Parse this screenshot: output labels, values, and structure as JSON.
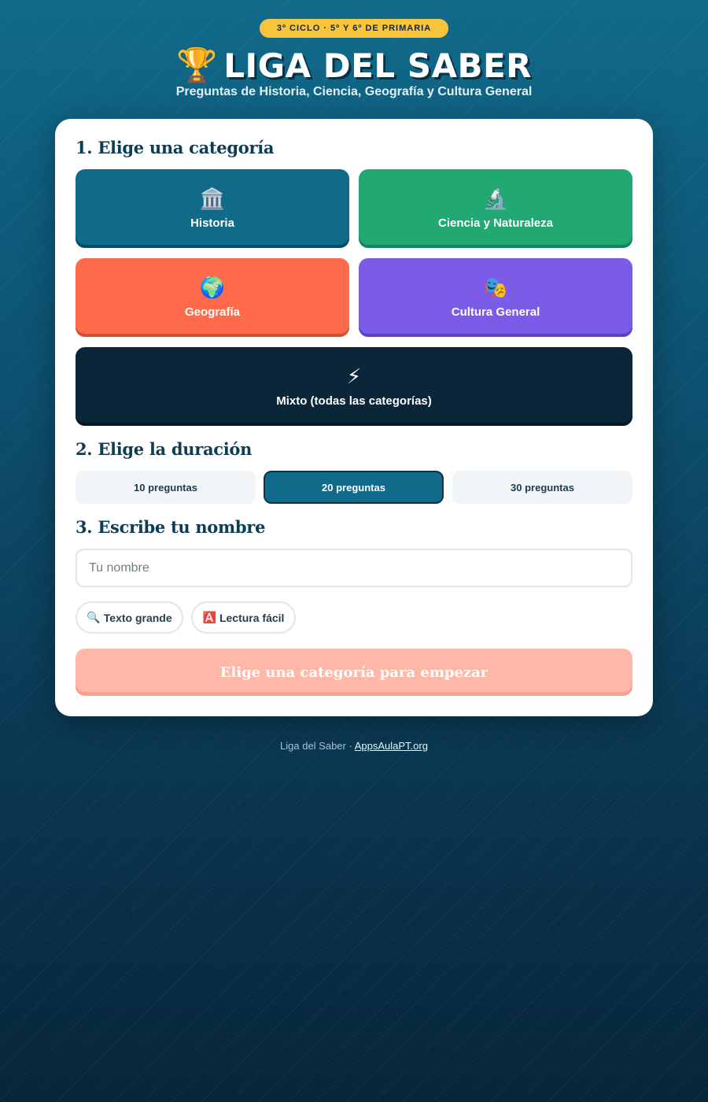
{
  "header": {
    "badge": "3º CICLO · 5º Y 6º DE PRIMARIA",
    "title_icon": "trophy-icon",
    "title": "LIGA DEL SABER",
    "subtitle": "Preguntas de Historia, Ciencia, Geografía y Cultura General"
  },
  "sections": {
    "category": "1. Elige una categoría",
    "duration": "2. Elige la duración",
    "name": "3. Escribe tu nombre"
  },
  "categories": [
    {
      "label": "Historia",
      "icon": "🏛️",
      "icon_name": "classical-building-icon",
      "color": "#106a8a"
    },
    {
      "label": "Ciencia y Naturaleza",
      "icon": "🔬",
      "icon_name": "microscope-icon",
      "color": "#22a873"
    },
    {
      "label": "Geografía",
      "icon": "🌍",
      "icon_name": "globe-icon",
      "color": "#ff6b4a"
    },
    {
      "label": "Cultura General",
      "icon": "🎭",
      "icon_name": "theater-masks-icon",
      "color": "#7b5ce9"
    },
    {
      "label": "Mixto (todas las categorías)",
      "icon": "⚡",
      "icon_name": "lightning-icon",
      "color": "#0b2638"
    }
  ],
  "durations": [
    {
      "label": "10 preguntas",
      "selected": false
    },
    {
      "label": "20 preguntas",
      "selected": true
    },
    {
      "label": "30 preguntas",
      "selected": false
    }
  ],
  "name_input": {
    "placeholder": "Tu nombre",
    "value": ""
  },
  "accessibility": [
    {
      "label": "Texto grande",
      "icon": "🔍",
      "icon_name": "magnifier-icon"
    },
    {
      "label": "Lectura fácil",
      "icon": "🅰️",
      "icon_name": "letter-a-icon"
    }
  ],
  "start_button": "Elige una categoría para empezar",
  "footer": {
    "text": "Liga del Saber · ",
    "link": "AppsAulaPT.org"
  },
  "colors": {
    "accent": "#106a8a",
    "badge": "#f8c43b",
    "start_disabled": "#ffb8a8"
  }
}
